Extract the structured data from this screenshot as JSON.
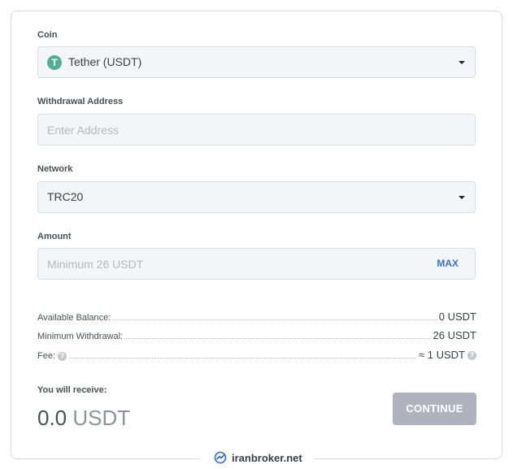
{
  "form": {
    "coin": {
      "label": "Coin",
      "selected": "Tether (USDT)",
      "icon": "tether-icon",
      "icon_glyph": "T",
      "icon_color": "#50af95"
    },
    "address": {
      "label": "Withdrawal Address",
      "placeholder": "Enter Address"
    },
    "network": {
      "label": "Network",
      "selected": "TRC20"
    },
    "amount": {
      "label": "Amount",
      "placeholder": "Minimum 26 USDT",
      "max_label": "MAX"
    }
  },
  "summary": {
    "available_balance": {
      "label": "Available Balance:",
      "value": "0 USDT"
    },
    "minimum_withdrawal": {
      "label": "Minimum Withdrawal:",
      "value": "26 USDT"
    },
    "fee": {
      "label": "Fee:",
      "value": "≈ 1 USDT",
      "help_glyph": "?"
    }
  },
  "receive": {
    "label": "You will receive:",
    "amount": "0.0",
    "unit": "USDT"
  },
  "actions": {
    "continue_label": "CONTINUE"
  },
  "watermark": {
    "text": "iranbroker.net"
  },
  "colors": {
    "accent": "#3a6fd8",
    "button_disabled": "#aeb3bd",
    "tether_green": "#50af95"
  }
}
